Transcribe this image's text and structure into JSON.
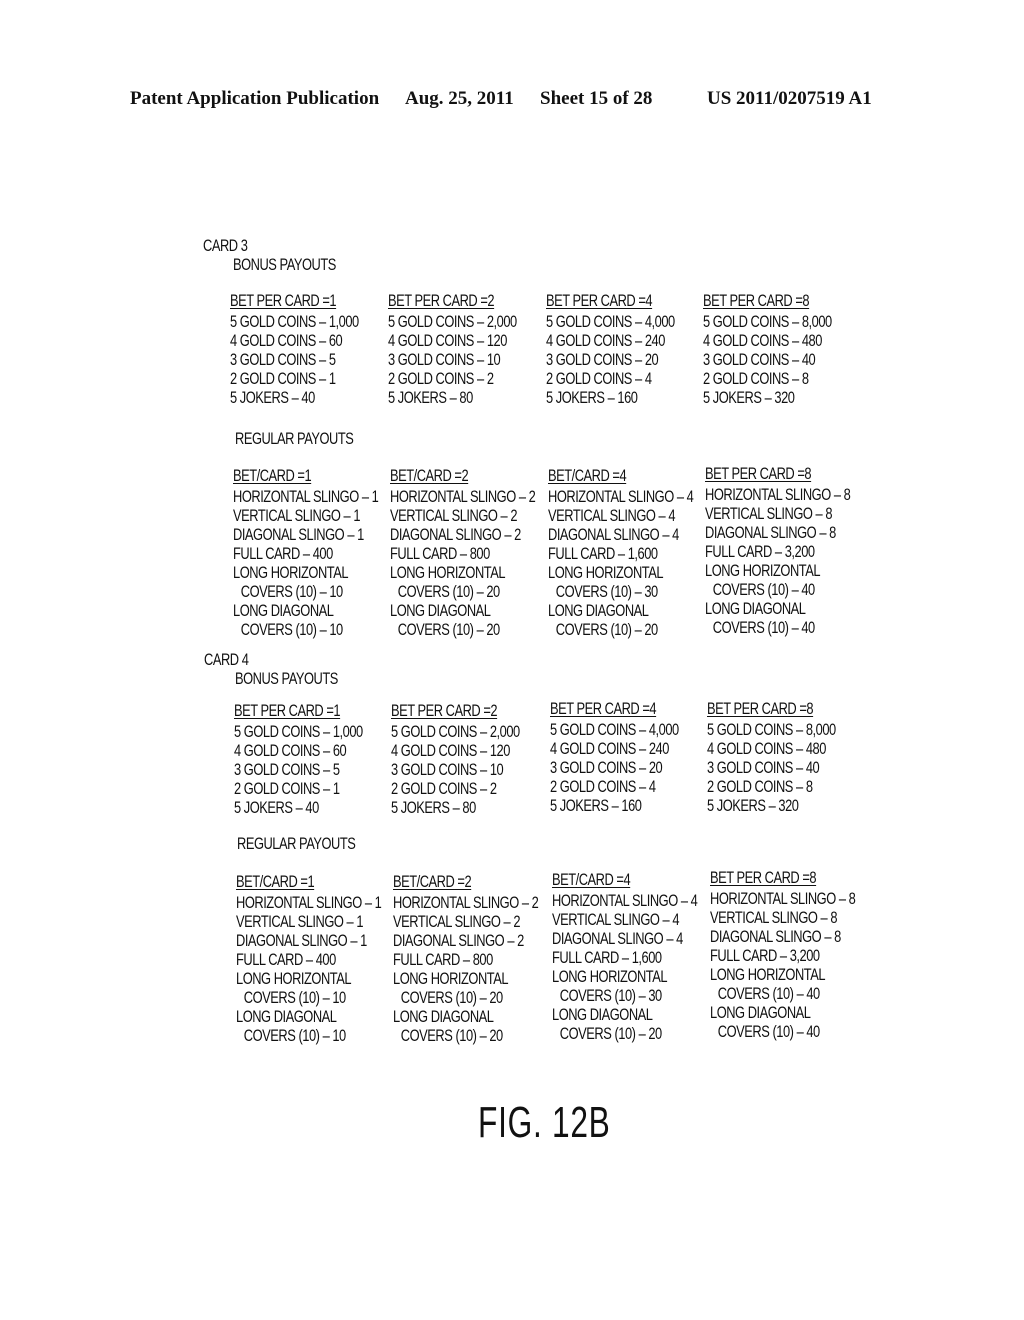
{
  "header": {
    "publication": "Patent Application Publication",
    "date": "Aug. 25, 2011",
    "sheet": "Sheet 15 of 28",
    "number": "US 2011/0207519 A1"
  },
  "cards": [
    {
      "title": "CARD 3",
      "bonus": {
        "title": "BONUS PAYOUTS",
        "columns": [
          {
            "head": "BET PER CARD =1",
            "lines": [
              "5 GOLD COINS – 1,000",
              "4 GOLD COINS – 60",
              "3 GOLD COINS – 5",
              "2 GOLD COINS – 1",
              "5 JOKERS – 40"
            ]
          },
          {
            "head": "BET PER CARD =2",
            "lines": [
              "5 GOLD COINS – 2,000",
              "4 GOLD COINS – 120",
              "3 GOLD COINS – 10",
              "2 GOLD COINS – 2",
              "5 JOKERS – 80"
            ]
          },
          {
            "head": "BET PER CARD =4",
            "lines": [
              "5 GOLD COINS – 4,000",
              "4 GOLD COINS – 240",
              "3 GOLD COINS – 20",
              "2 GOLD COINS – 4",
              "5 JOKERS – 160"
            ]
          },
          {
            "head": "BET PER CARD =8",
            "lines": [
              "5 GOLD COINS – 8,000",
              "4 GOLD COINS – 480",
              "3 GOLD COINS – 40",
              "2 GOLD COINS – 8",
              "5 JOKERS – 320"
            ]
          }
        ]
      },
      "regular": {
        "title": "REGULAR PAYOUTS",
        "columns": [
          {
            "head": "BET/CARD =1",
            "lines": [
              "HORIZONTAL SLINGO – 1",
              "VERTICAL SLINGO – 1",
              "DIAGONAL SLINGO – 1",
              "FULL CARD – 400",
              "LONG HORIZONTAL",
              "COVERS (10) – 10",
              "LONG DIAGONAL",
              "COVERS (10) – 10"
            ]
          },
          {
            "head": "BET/CARD =2",
            "lines": [
              "HORIZONTAL SLINGO – 2",
              "VERTICAL SLINGO – 2",
              "DIAGONAL SLINGO – 2",
              "FULL CARD – 800",
              "LONG HORIZONTAL",
              "COVERS (10) – 20",
              "LONG DIAGONAL",
              "COVERS (10) – 20"
            ]
          },
          {
            "head": "BET/CARD =4",
            "lines": [
              "HORIZONTAL SLINGO – 4",
              "VERTICAL SLINGO – 4",
              "DIAGONAL SLINGO – 4",
              "FULL CARD – 1,600",
              "LONG HORIZONTAL",
              "COVERS (10) – 30",
              "LONG DIAGONAL",
              "COVERS (10) – 20"
            ]
          },
          {
            "head": "BET PER CARD =8",
            "lines": [
              "HORIZONTAL SLINGO – 8",
              "VERTICAL SLINGO – 8",
              "DIAGONAL SLINGO – 8",
              "FULL CARD – 3,200",
              "LONG HORIZONTAL",
              "COVERS (10) – 40",
              "LONG DIAGONAL",
              "COVERS (10) – 40"
            ]
          }
        ]
      }
    },
    {
      "title": "CARD 4",
      "bonus": {
        "title": "BONUS PAYOUTS",
        "columns": [
          {
            "head": "BET PER CARD =1",
            "lines": [
              "5 GOLD COINS – 1,000",
              "4 GOLD COINS – 60",
              "3 GOLD COINS – 5",
              "2 GOLD COINS – 1",
              "5 JOKERS – 40"
            ]
          },
          {
            "head": "BET PER CARD =2",
            "lines": [
              "5 GOLD COINS – 2,000",
              "4 GOLD COINS – 120",
              "3 GOLD COINS – 10",
              "2 GOLD COINS – 2",
              "5 JOKERS – 80"
            ]
          },
          {
            "head": "BET PER CARD =4",
            "lines": [
              "5 GOLD COINS – 4,000",
              "4 GOLD COINS – 240",
              "3 GOLD COINS – 20",
              "2 GOLD COINS – 4",
              "5 JOKERS – 160"
            ]
          },
          {
            "head": "BET PER CARD =8",
            "lines": [
              "5 GOLD COINS – 8,000",
              "4 GOLD COINS – 480",
              "3 GOLD COINS – 40",
              "2 GOLD COINS – 8",
              "5 JOKERS – 320"
            ]
          }
        ]
      },
      "regular": {
        "title": "REGULAR PAYOUTS",
        "columns": [
          {
            "head": "BET/CARD =1",
            "lines": [
              "HORIZONTAL SLINGO – 1",
              "VERTICAL SLINGO – 1",
              "DIAGONAL SLINGO – 1",
              "FULL CARD – 400",
              "LONG HORIZONTAL",
              "COVERS (10) – 10",
              "LONG DIAGONAL",
              "COVERS (10) – 10"
            ]
          },
          {
            "head": "BET/CARD =2",
            "lines": [
              "HORIZONTAL SLINGO – 2",
              "VERTICAL SLINGO – 2",
              "DIAGONAL SLINGO – 2",
              "FULL CARD – 800",
              "LONG HORIZONTAL",
              "COVERS (10) – 20",
              "LONG DIAGONAL",
              "COVERS (10) – 20"
            ]
          },
          {
            "head": "BET/CARD =4",
            "lines": [
              "HORIZONTAL SLINGO – 4",
              "VERTICAL SLINGO – 4",
              "DIAGONAL SLINGO – 4",
              "FULL CARD – 1,600",
              "LONG HORIZONTAL",
              "COVERS (10) – 30",
              "LONG DIAGONAL",
              "COVERS (10) – 20"
            ]
          },
          {
            "head": "BET PER CARD =8",
            "lines": [
              "HORIZONTAL SLINGO – 8",
              "VERTICAL SLINGO – 8",
              "DIAGONAL SLINGO – 8",
              "FULL CARD – 3,200",
              "LONG HORIZONTAL",
              "COVERS (10) – 40",
              "LONG DIAGONAL",
              "COVERS (10) – 40"
            ]
          }
        ]
      }
    }
  ],
  "figure_label": "FIG. 12B"
}
